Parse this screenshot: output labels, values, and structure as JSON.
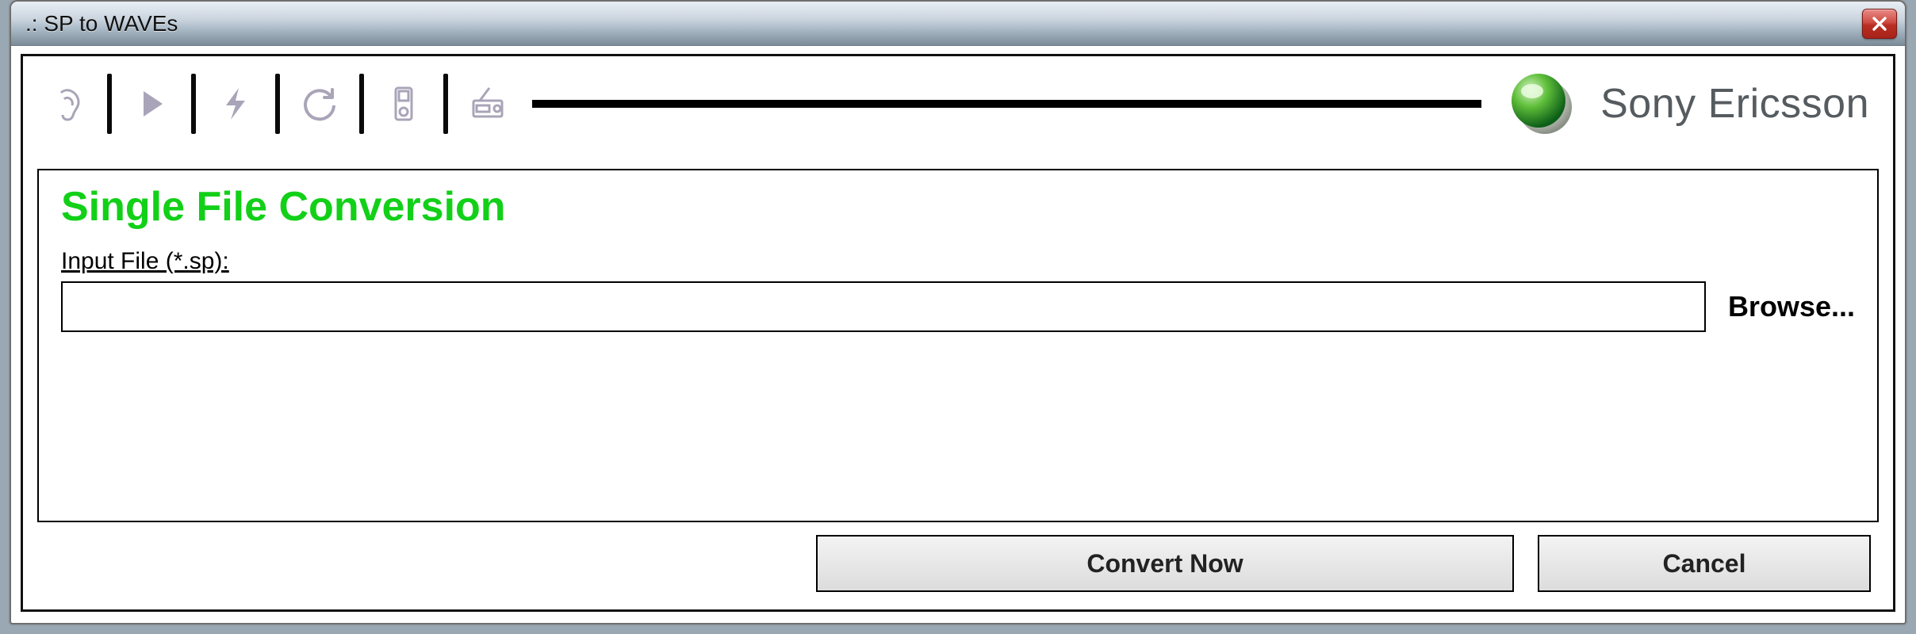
{
  "window": {
    "title": ".: SP to WAVEs"
  },
  "brand": {
    "text": "Sony Ericsson"
  },
  "toolbar": {
    "icons": [
      "ear-icon",
      "play-icon",
      "lightning-icon",
      "refresh-icon",
      "device-icon",
      "radio-icon"
    ]
  },
  "panel": {
    "title": "Single File Conversion",
    "input_label": "Input File (*.sp):",
    "input_value": "",
    "browse_label": "Browse..."
  },
  "buttons": {
    "convert": "Convert Now",
    "cancel": "Cancel"
  }
}
